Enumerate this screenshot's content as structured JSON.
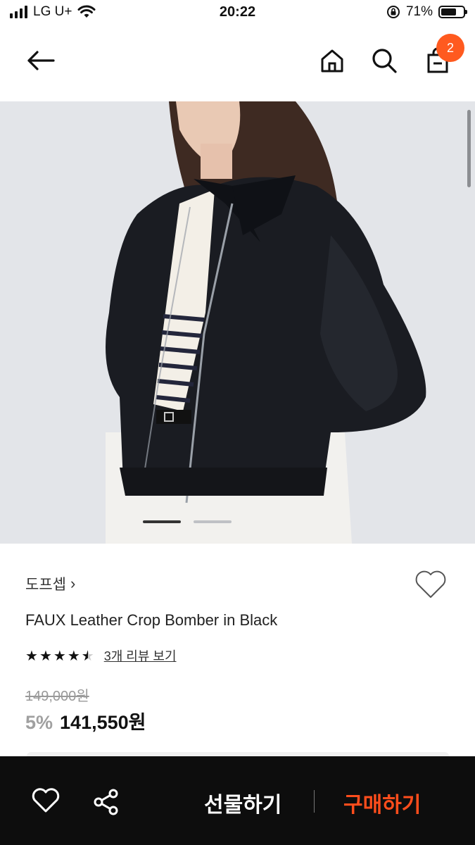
{
  "status": {
    "carrier": "LG U+",
    "time": "20:22",
    "battery": "71%",
    "battery_level": 0.71
  },
  "nav": {
    "cart_badge": "2",
    "icons": [
      "back-arrow-icon",
      "home-icon",
      "search-icon",
      "shopping-bag-icon"
    ]
  },
  "gallery": {
    "image_alt": "faux leather crop bomber jacket photo",
    "total_slides": 2,
    "current_slide": 1
  },
  "product": {
    "brand": "도프셉",
    "brand_chevron": "›",
    "title": "FAUX Leather Crop Bomber in Black",
    "rating": 4.5,
    "review_link": "3개 리뷰 보기",
    "original_price": "149,000원",
    "discount": "5%",
    "price": "141,550원"
  },
  "bottom_bar": {
    "gift_label": "선물하기",
    "buy_label": "구매하기",
    "icons": [
      "heart-outline-icon",
      "share-icon"
    ]
  },
  "colors": {
    "accent": "#ff4d1c",
    "badge": "#ff5a1f",
    "bottom_bar_bg": "#0d0d0d"
  }
}
